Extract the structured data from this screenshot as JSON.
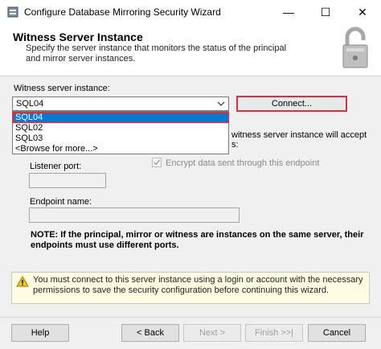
{
  "window": {
    "title": "Configure Database Mirroring Security Wizard",
    "minimize_glyph": "—",
    "maximize_glyph": "☐",
    "close_glyph": "✕"
  },
  "header": {
    "title": "Witness Server Instance",
    "subtitle": "Specify the server instance that monitors the status of the principal and mirror server instances.",
    "icon": "padlock-icon"
  },
  "form": {
    "witness_label": "Witness server instance:",
    "witness_value": "SQL04",
    "connect_label": "Connect...",
    "options": [
      "SQL04",
      "SQL02",
      "SQL03",
      "<Browse for more...>"
    ],
    "selected_option": "SQL04",
    "partial_line_1": "witness server instance will accept",
    "partial_line_2": "s:",
    "listener_label": "Listener port:",
    "listener_value": "",
    "encrypt_label": "Encrypt data sent through this endpoint",
    "encrypt_checked": true,
    "endpoint_label": "Endpoint name:",
    "endpoint_value": ""
  },
  "note": "NOTE: If the principal, mirror or witness are instances on the same server, their endpoints must use different ports.",
  "warning": {
    "text": "You must connect to this server instance using a login or account with the necessary permissions to save the security configuration before continuing this wizard.",
    "icon": "warning-icon"
  },
  "footer": {
    "help": "Help",
    "back": "< Back",
    "next": "Next >",
    "finish": "Finish >>|",
    "cancel": "Cancel"
  },
  "colors": {
    "highlight": "#d0353d",
    "selection": "#0078d7",
    "warning_bg": "#fffde1"
  }
}
